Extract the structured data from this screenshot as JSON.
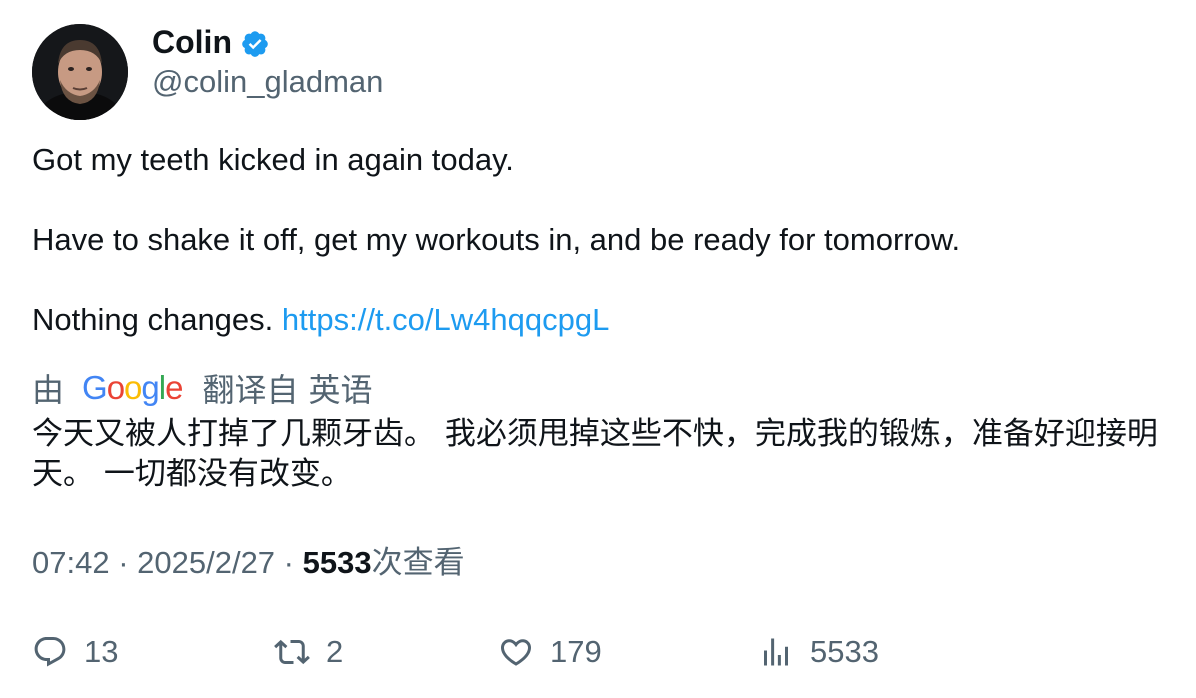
{
  "author": {
    "display_name": "Colin",
    "handle": "@colin_gladman",
    "verified": true,
    "verified_color": "#1d9bf0"
  },
  "tweet": {
    "lines": [
      "Got my teeth kicked in again today.",
      "Have to shake it off, get my workouts in, and be ready for tomorrow.",
      "Nothing changes."
    ],
    "link": "https://t.co/Lw4hqqcpgL"
  },
  "translation": {
    "by_label": "由",
    "provider": "Google",
    "from_label": "翻译自",
    "language": "英语",
    "text": "今天又被人打掉了几颗牙齿。 我必须甩掉这些不快，完成我的锻炼，准备好迎接明天。 一切都没有改变。"
  },
  "meta": {
    "time": "07:42",
    "separator": " · ",
    "date": "2025/2/27",
    "views_count": "5533",
    "views_label": "次查看"
  },
  "actions": {
    "reply_count": "13",
    "retweet_count": "2",
    "like_count": "179",
    "view_count": "5533"
  },
  "colors": {
    "text": "#0f1419",
    "secondary": "#536471",
    "link": "#1d9bf0"
  }
}
